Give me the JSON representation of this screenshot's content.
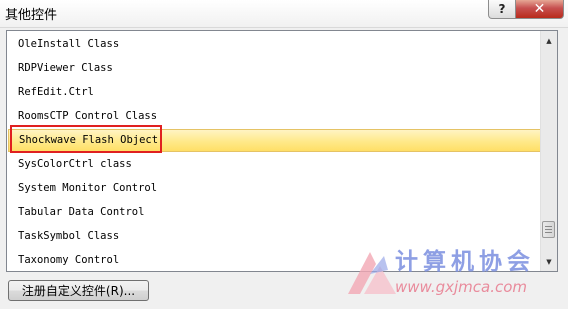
{
  "window": {
    "title": "其他控件",
    "help_label": "?",
    "close_label": "✕"
  },
  "controls_list": {
    "items": [
      {
        "label": "OleInstall Class"
      },
      {
        "label": "RDPViewer Class"
      },
      {
        "label": "RefEdit.Ctrl"
      },
      {
        "label": "RoomsCTP Control Class"
      },
      {
        "label": "Shockwave Flash Object",
        "selected": true
      },
      {
        "label": "SysColorCtrl class"
      },
      {
        "label": "System Monitor Control"
      },
      {
        "label": "Tabular Data Control"
      },
      {
        "label": "TaskSymbol Class"
      },
      {
        "label": "Taxonomy Control"
      }
    ],
    "selected_label": "Shockwave Flash Object",
    "scroll_up_glyph": "▲",
    "scroll_down_glyph": "▼"
  },
  "buttons": {
    "register_label": "注册自定义控件(R)..."
  },
  "watermark": {
    "text": "计算机协会",
    "url": "www.gxjmca.com"
  },
  "colors": {
    "selection_fill": "#ffe98a",
    "highlight_box": "#e02020",
    "close_button": "#c75050"
  },
  "icons": {
    "help": "help-icon",
    "close": "close-icon",
    "scroll_up": "up-arrow-icon",
    "scroll_down": "down-arrow-icon"
  }
}
